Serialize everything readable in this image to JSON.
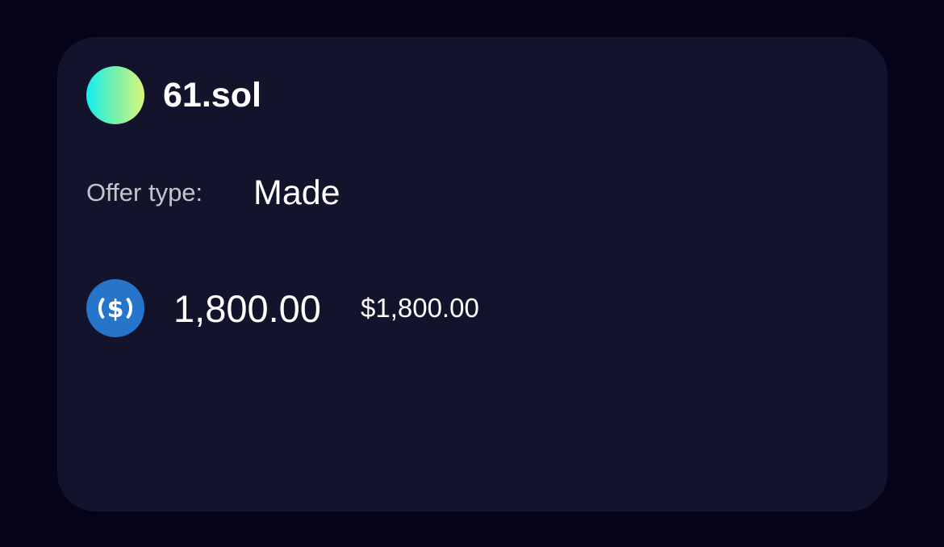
{
  "offer_card": {
    "domain_name": "61.sol",
    "offer_type_label": "Offer type:",
    "offer_type_value": "Made",
    "token": {
      "icon": "usdc-icon",
      "amount": "1,800.00",
      "fiat_value": "$1,800.00"
    }
  },
  "colors": {
    "page_background": "#05041a",
    "card_background": "#13142b",
    "token_blue": "#2775ca",
    "text_primary": "#ffffff",
    "text_secondary": "#c4c4cc"
  }
}
